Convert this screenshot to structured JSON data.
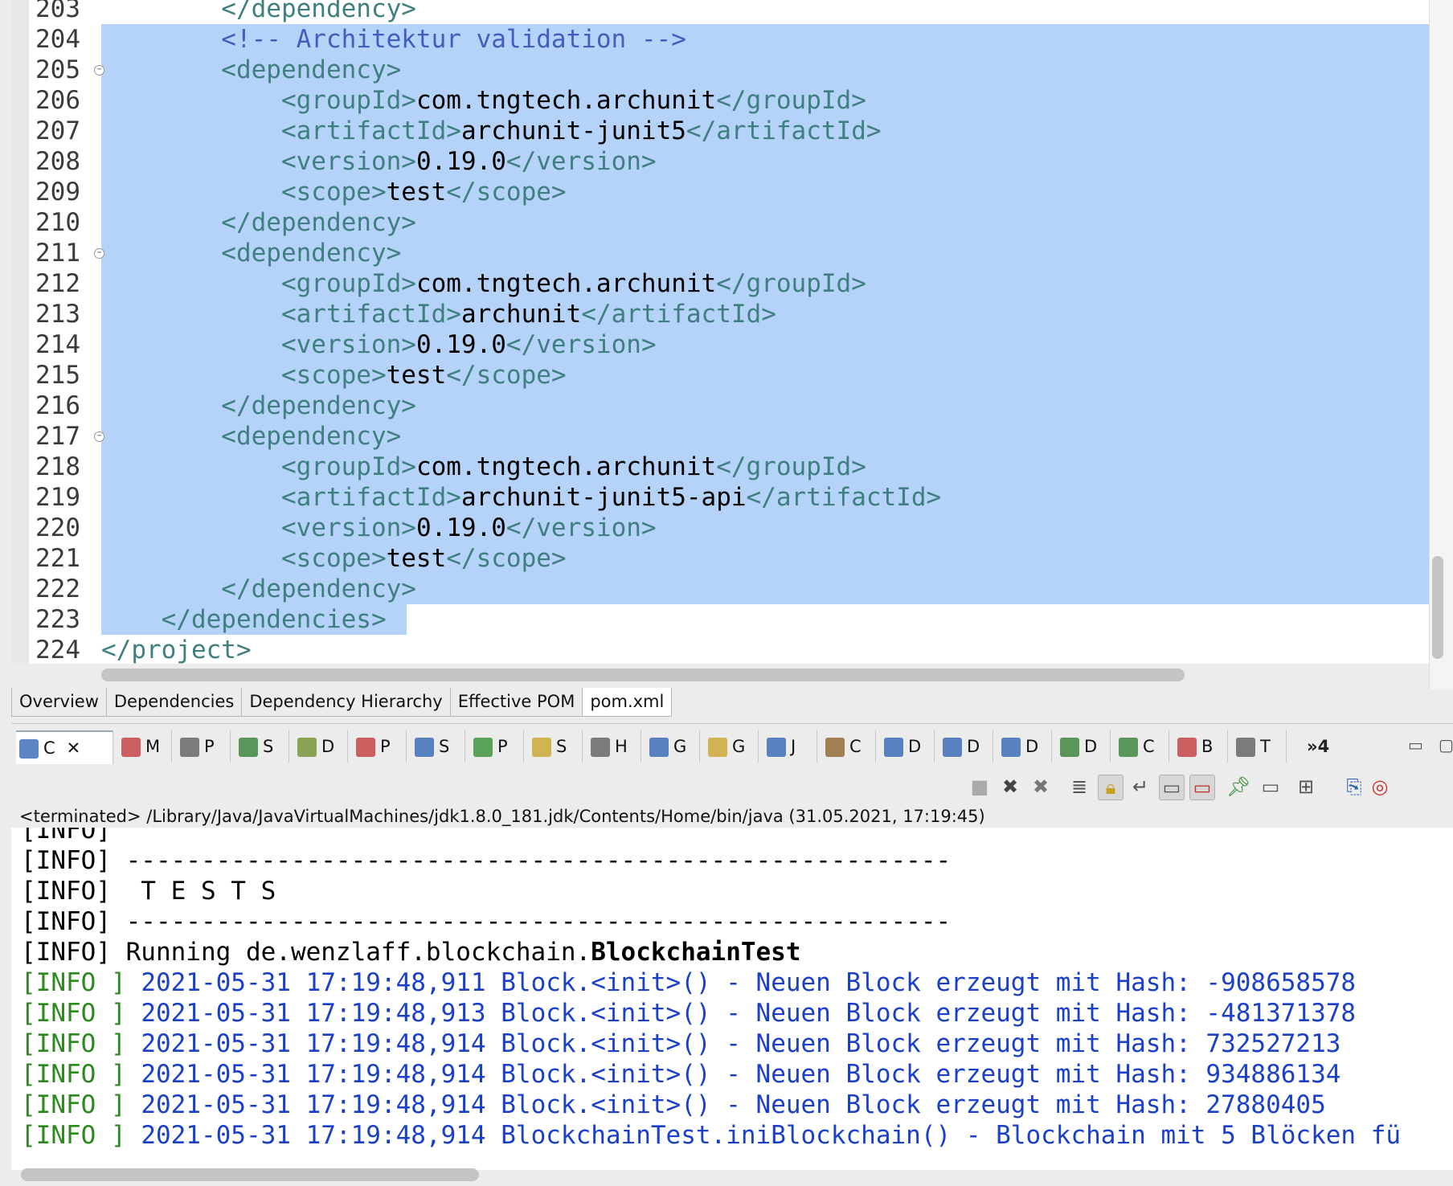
{
  "editor": {
    "lines": [
      {
        "num": "203",
        "segs": [
          [
            "tg",
            "        </dependency>"
          ]
        ],
        "sel": false,
        "fold": false
      },
      {
        "num": "204",
        "segs": [
          [
            "cm",
            "        <!-- Architektur validation -->"
          ]
        ],
        "sel": true,
        "fold": false
      },
      {
        "num": "205",
        "segs": [
          [
            "tg",
            "        <dependency>"
          ]
        ],
        "sel": true,
        "fold": true
      },
      {
        "num": "206",
        "segs": [
          [
            "tg",
            "            <groupId>"
          ],
          [
            "tx",
            "com.tngtech.archunit"
          ],
          [
            "tg",
            "</groupId>"
          ]
        ],
        "sel": true,
        "fold": false
      },
      {
        "num": "207",
        "segs": [
          [
            "tg",
            "            <artifactId>"
          ],
          [
            "tx",
            "archunit-junit5"
          ],
          [
            "tg",
            "</artifactId>"
          ]
        ],
        "sel": true,
        "fold": false
      },
      {
        "num": "208",
        "segs": [
          [
            "tg",
            "            <version>"
          ],
          [
            "tx",
            "0.19.0"
          ],
          [
            "tg",
            "</version>"
          ]
        ],
        "sel": true,
        "fold": false
      },
      {
        "num": "209",
        "segs": [
          [
            "tg",
            "            <scope>"
          ],
          [
            "tx",
            "test"
          ],
          [
            "tg",
            "</scope>"
          ]
        ],
        "sel": true,
        "fold": false
      },
      {
        "num": "210",
        "segs": [
          [
            "tg",
            "        </dependency>"
          ]
        ],
        "sel": true,
        "fold": false
      },
      {
        "num": "211",
        "segs": [
          [
            "tg",
            "        <dependency>"
          ]
        ],
        "sel": true,
        "fold": true
      },
      {
        "num": "212",
        "segs": [
          [
            "tg",
            "            <groupId>"
          ],
          [
            "tx",
            "com.tngtech.archunit"
          ],
          [
            "tg",
            "</groupId>"
          ]
        ],
        "sel": true,
        "fold": false
      },
      {
        "num": "213",
        "segs": [
          [
            "tg",
            "            <artifactId>"
          ],
          [
            "tx",
            "archunit"
          ],
          [
            "tg",
            "</artifactId>"
          ]
        ],
        "sel": true,
        "fold": false
      },
      {
        "num": "214",
        "segs": [
          [
            "tg",
            "            <version>"
          ],
          [
            "tx",
            "0.19.0"
          ],
          [
            "tg",
            "</version>"
          ]
        ],
        "sel": true,
        "fold": false
      },
      {
        "num": "215",
        "segs": [
          [
            "tg",
            "            <scope>"
          ],
          [
            "tx",
            "test"
          ],
          [
            "tg",
            "</scope>"
          ]
        ],
        "sel": true,
        "fold": false
      },
      {
        "num": "216",
        "segs": [
          [
            "tg",
            "        </dependency>"
          ]
        ],
        "sel": true,
        "fold": false
      },
      {
        "num": "217",
        "segs": [
          [
            "tg",
            "        <dependency>"
          ]
        ],
        "sel": true,
        "fold": true
      },
      {
        "num": "218",
        "segs": [
          [
            "tg",
            "            <groupId>"
          ],
          [
            "tx",
            "com.tngtech.archunit"
          ],
          [
            "tg",
            "</groupId>"
          ]
        ],
        "sel": true,
        "fold": false
      },
      {
        "num": "219",
        "segs": [
          [
            "tg",
            "            <artifactId>"
          ],
          [
            "tx",
            "archunit-junit5-api"
          ],
          [
            "tg",
            "</artifactId>"
          ]
        ],
        "sel": true,
        "fold": false
      },
      {
        "num": "220",
        "segs": [
          [
            "tg",
            "            <version>"
          ],
          [
            "tx",
            "0.19.0"
          ],
          [
            "tg",
            "</version>"
          ]
        ],
        "sel": true,
        "fold": false
      },
      {
        "num": "221",
        "segs": [
          [
            "tg",
            "            <scope>"
          ],
          [
            "tx",
            "test"
          ],
          [
            "tg",
            "</scope>"
          ]
        ],
        "sel": true,
        "fold": false
      },
      {
        "num": "222",
        "segs": [
          [
            "tg",
            "        </dependency>"
          ]
        ],
        "sel": true,
        "fold": false
      },
      {
        "num": "223",
        "segs": [
          [
            "tg",
            "    </dependencies>"
          ]
        ],
        "sel": "partial",
        "fold": false
      },
      {
        "num": "224",
        "segs": [
          [
            "tg",
            "</project>"
          ]
        ],
        "sel": false,
        "fold": false
      }
    ]
  },
  "editor_tabs": [
    {
      "label": "Overview",
      "active": false
    },
    {
      "label": "Dependencies",
      "active": false
    },
    {
      "label": "Dependency Hierarchy",
      "active": false
    },
    {
      "label": "Effective POM",
      "active": false
    },
    {
      "label": "pom.xml",
      "active": true
    }
  ],
  "view_tabs": [
    {
      "label": "C",
      "icon": "console-icon",
      "close": true
    },
    {
      "label": "M",
      "icon": "markers-icon"
    },
    {
      "label": "P",
      "icon": "properties-icon"
    },
    {
      "label": "S",
      "icon": "servers-icon"
    },
    {
      "label": "D",
      "icon": "data-source-icon"
    },
    {
      "label": "P",
      "icon": "problems-icon"
    },
    {
      "label": "S",
      "icon": "snippets-icon"
    },
    {
      "label": "P",
      "icon": "progress-icon"
    },
    {
      "label": "S",
      "icon": "search-icon"
    },
    {
      "label": "H",
      "icon": "history-icon"
    },
    {
      "label": "G",
      "icon": "git-staging-icon"
    },
    {
      "label": "G",
      "icon": "git-repositories-icon"
    },
    {
      "label": "J",
      "icon": "javadoc-icon"
    },
    {
      "label": "C",
      "icon": "call-hierarchy-icon"
    },
    {
      "label": "D",
      "icon": "declaration-icon"
    },
    {
      "label": "D",
      "icon": "debug-icon"
    },
    {
      "label": "D",
      "icon": "display-icon"
    },
    {
      "label": "D",
      "icon": "dependency-icon"
    },
    {
      "label": "C",
      "icon": "coverage-icon"
    },
    {
      "label": "B",
      "icon": "breakpoints-icon"
    },
    {
      "label": "T",
      "icon": "terminal-icon"
    }
  ],
  "view_overflow": "»4",
  "console": {
    "status": "<terminated> /Library/Java/JavaVirtualMachines/jdk1.8.0_181.jdk/Contents/Home/bin/java (31.05.2021, 17:19:45)",
    "lines": [
      {
        "type": "plain",
        "text": "[INFO]"
      },
      {
        "type": "plain",
        "text": "[INFO] -------------------------------------------------------"
      },
      {
        "type": "plain",
        "text": "[INFO]  T E S T S"
      },
      {
        "type": "plain",
        "text": "[INFO] -------------------------------------------------------"
      },
      {
        "type": "running",
        "prefix": "[INFO] Running de.wenzlaff.blockchain.",
        "bold": "BlockchainTest"
      },
      {
        "type": "log",
        "level": "[INFO ]",
        "text": " 2021-05-31 17:19:48,911 Block.<init>() - Neuen Block erzeugt mit Hash: -908658578"
      },
      {
        "type": "log",
        "level": "[INFO ]",
        "text": " 2021-05-31 17:19:48,913 Block.<init>() - Neuen Block erzeugt mit Hash: -481371378"
      },
      {
        "type": "log",
        "level": "[INFO ]",
        "text": " 2021-05-31 17:19:48,914 Block.<init>() - Neuen Block erzeugt mit Hash: 732527213"
      },
      {
        "type": "log",
        "level": "[INFO ]",
        "text": " 2021-05-31 17:19:48,914 Block.<init>() - Neuen Block erzeugt mit Hash: 934886134"
      },
      {
        "type": "log",
        "level": "[INFO ]",
        "text": " 2021-05-31 17:19:48,914 Block.<init>() - Neuen Block erzeugt mit Hash: 27880405"
      },
      {
        "type": "log",
        "level": "[INFO ]",
        "text": " 2021-05-31 17:19:48,914 BlockchainTest.iniBlockchain() - Blockchain mit 5 Blöcken fü"
      }
    ]
  },
  "toolbar": {
    "buttons": [
      {
        "name": "terminate-button",
        "glyph": "■"
      },
      {
        "name": "remove-launch-button",
        "glyph": "✖"
      },
      {
        "name": "remove-all-terminated-button",
        "glyph": "✖"
      },
      {
        "name": "clear-console-button",
        "glyph": "≣"
      },
      {
        "name": "scroll-lock-button",
        "glyph": "🔒︎"
      },
      {
        "name": "word-wrap-button",
        "glyph": "↵"
      },
      {
        "name": "show-stdout-button",
        "glyph": "▭"
      },
      {
        "name": "show-stderr-button",
        "glyph": "▭"
      },
      {
        "name": "pin-console-button",
        "glyph": "📌︎"
      },
      {
        "name": "display-console-button",
        "glyph": "▭"
      },
      {
        "name": "open-console-button",
        "glyph": "⊞"
      },
      {
        "name": "copy-button",
        "glyph": "⎘"
      },
      {
        "name": "help-button",
        "glyph": "◎"
      }
    ]
  }
}
